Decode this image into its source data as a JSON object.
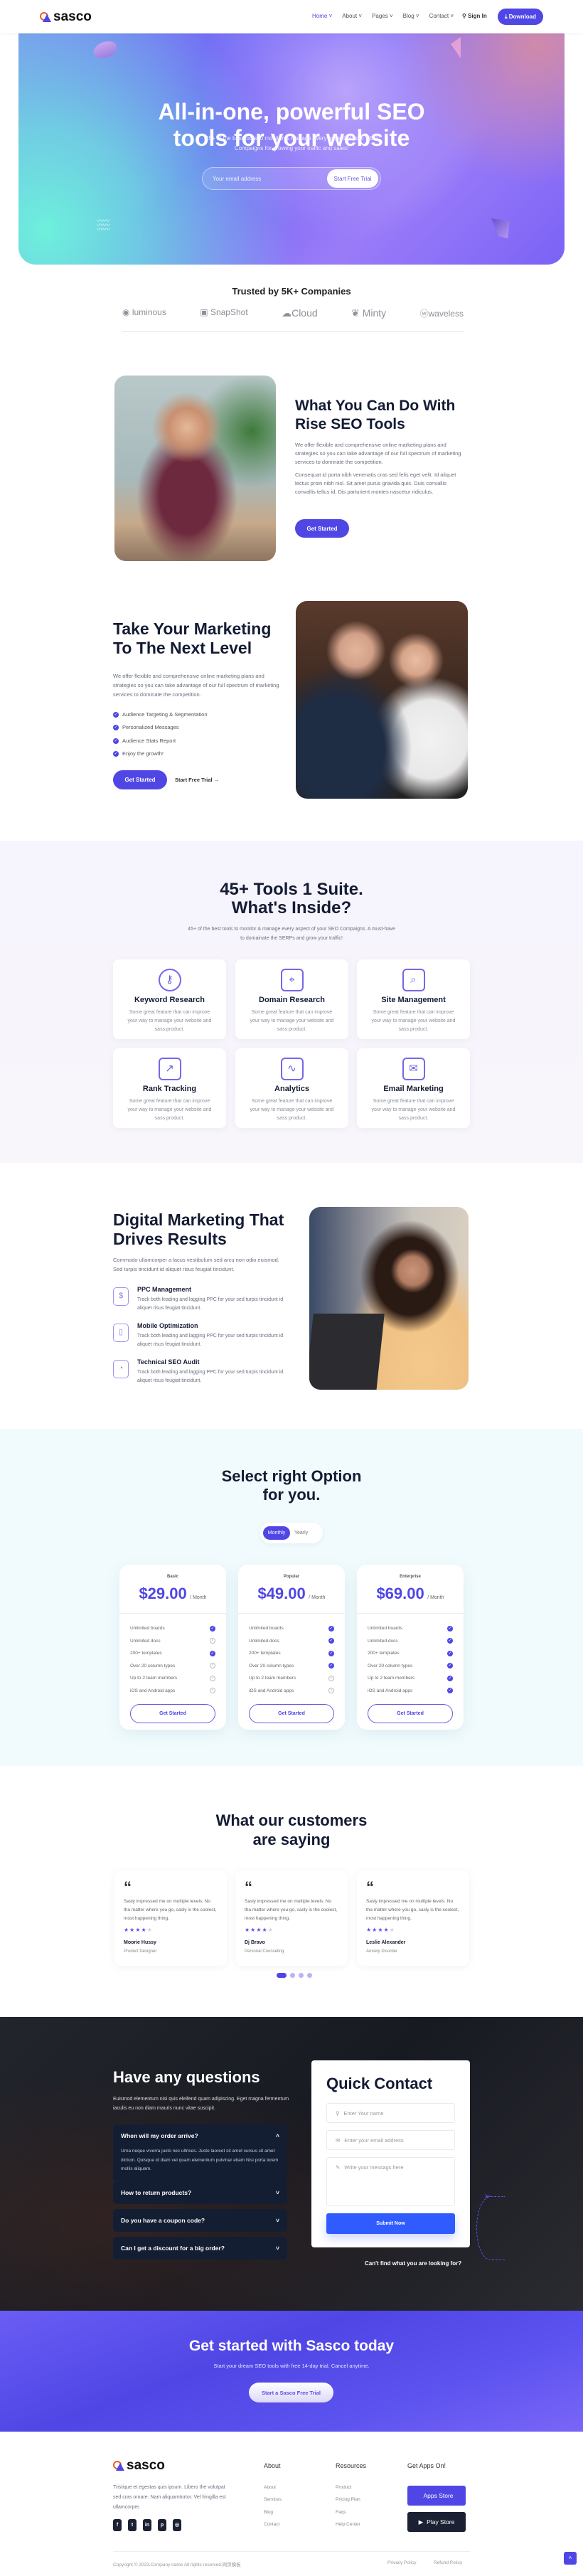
{
  "colors": {
    "primary": "#4f46e5",
    "heading": "#141b34",
    "accent_orange": "#f05a28",
    "dark_bg": "#1c2030"
  },
  "header": {
    "logo": "sasco",
    "nav": [
      "Home",
      "About",
      "Pages",
      "Blog",
      "Contact"
    ],
    "sign_in": "Sign In",
    "download": "Download"
  },
  "hero": {
    "title_line1": "All-in-one, powerful SEO",
    "title_line2": "tools for your website",
    "subtitle_line1": "45+ of the best tools to monitor & manage every aspect of your SEO",
    "subtitle_line2": "Compaigns for growing your traffic and sales!",
    "email_placeholder": "Your email address",
    "cta": "Start Free Trial"
  },
  "trusted": {
    "title": "Trusted by 5K+ Companies",
    "logos": [
      "luminous",
      "SnapShot",
      "Cloud",
      "Minty",
      "waveless"
    ]
  },
  "rise": {
    "title_line1": "What You Can Do With",
    "title_line2": "Rise SEO Tools",
    "para1": "We offer flexible and comprehensive online marketing plans and strategies so you can take advantage of our full spectrum of marketing services to dominate the competition.",
    "para2": "Consequat id porta nibh venenatis cras sed felis eget velit. Id aliquet lectus proin nibh nisl. Sit amet purus gravida quis. Duis convallis convallis tellus id. Dis parturient montes nascetur ridiculus.",
    "button": "Get Started"
  },
  "marketing": {
    "title_line1": "Take Your Marketing",
    "title_line2": "To The Next Level",
    "para": "We offer flexible and comprehensive online marketing plans and strategies so you can take advantage of our full spectrum of marketing services to dominate the competition.",
    "list": [
      "Audience Targeting & Segmentation",
      "Personalized Messages",
      "Audience Stats Report",
      "Enjoy the growth!"
    ],
    "primary_button": "Get Started",
    "secondary_button": "Start Free Trial"
  },
  "tools": {
    "title_line1": "45+ Tools 1 Suite.",
    "title_line2": "What's Inside?",
    "subtitle_line1": "45+ of the best tools to monitor & manage every aspect of your SEO Compaigns. A must-have",
    "subtitle_line2": "to domainate the SERPs and grow your traffic!",
    "cards": [
      {
        "icon": "key-search-icon",
        "title": "Keyword Research",
        "desc": "Some great feature that can improve your way to manage your website and sass product."
      },
      {
        "icon": "browser-cursor-icon",
        "title": "Domain Research",
        "desc": "Some great feature that can improve your way to manage your website and sass product."
      },
      {
        "icon": "site-search-icon",
        "title": "Site Management",
        "desc": "Some great feature that can improve your way to manage your website and sass product."
      },
      {
        "icon": "trend-chart-icon",
        "title": "Rank Tracking",
        "desc": "Some great feature that can improve your way to manage your website and sass product."
      },
      {
        "icon": "analytics-icon",
        "title": "Analytics",
        "desc": "Some great feature that can improve your way to manage your website and sass product."
      },
      {
        "icon": "email-megaphone-icon",
        "title": "Email Marketing",
        "desc": "Some great feature that can improve your way to manage your website and sass product."
      }
    ]
  },
  "digital": {
    "title_line1": "Digital Marketing That",
    "title_line2": "Drives Results",
    "para": "Commodo ullamcorper a lacus vestibulum sed arcu non odio euismod. Sed turpis tincidunt id aliquet risus feugiat tincidunt.",
    "features": [
      {
        "icon": "mouse-dollar-icon",
        "title": "PPC Management",
        "desc": "Track both leading and lagging PPC for your sed turpis tincidunt id aliquet risus feugiat tincidunt."
      },
      {
        "icon": "mobile-icon",
        "title": "Mobile Optimization",
        "desc": "Track both leading and lagging PPC for your sed turpis tincidunt id aliquet risus feugiat tincidunt."
      },
      {
        "icon": "presentation-icon",
        "title": "Technical SEO Audit",
        "desc": "Track both leading and lagging PPC for your sed turpis tincidunt id aliquet risus feugiat tincidunt."
      }
    ]
  },
  "pricing": {
    "title_line1": "Select right Option",
    "title_line2": "for you.",
    "toggle": [
      "Monthly",
      "Yearly"
    ],
    "toggle_selected": "Monthly",
    "feature_names": [
      "Unlimited boards",
      "Unlimited docs",
      "200+ templates",
      "Over 20 column types",
      "Up to 2 team members",
      "iOS and Android apps"
    ],
    "plans": [
      {
        "name": "Basic",
        "price": "$29.00",
        "period": "/ Month",
        "included": [
          true,
          false,
          true,
          false,
          false,
          false
        ],
        "button": "Get Started"
      },
      {
        "name": "Popular",
        "price": "$49.00",
        "period": "/ Month",
        "included": [
          true,
          true,
          true,
          true,
          false,
          false
        ],
        "button": "Get Started"
      },
      {
        "name": "Enterprise",
        "price": "$69.00",
        "period": "/ Month",
        "included": [
          true,
          true,
          true,
          true,
          true,
          true
        ],
        "button": "Get Started"
      }
    ]
  },
  "testimonials": {
    "title_line1": "What our customers",
    "title_line2": "are saying",
    "items": [
      {
        "quote": "Sasly impressed me on multiple levels. No tha matter where you go, sasly is the coolest, most happening thing.",
        "rating": 4,
        "name": "Moorie Hussy",
        "role": "Product Designer"
      },
      {
        "quote": "Sasly impressed me on multiple levels. No tha matter where you go, sasly is the coolest, most happening thing.",
        "rating": 4,
        "name": "Dj Bravo",
        "role": "Personal Counseling"
      },
      {
        "quote": "Sasly impressed me on multiple levels. No tha matter where you go, sasly is the coolest, most happening thing.",
        "rating": 4,
        "name": "Leslie Alexander",
        "role": "Anxiety Disorder"
      }
    ],
    "pages": 4,
    "active_page": 1
  },
  "faq": {
    "title": "Have any questions",
    "para": "Euismod elementum nisi quis eleifend quam adipiscing. Eget magna fermentum iaculis eu non diam mauris nunc vitae suscipit.",
    "items": [
      {
        "q": "When will my order arrive?",
        "a": "Urna neque viverra justo nec ultrices. Justo laoreet sit amet cursus sit amet dictum. Quisque id diam vel quam elementum pulvinar etiam Nisi porta lorem mollis aliquam.",
        "open": true
      },
      {
        "q": "How to return products?",
        "open": false
      },
      {
        "q": "Do you have a coupon code?",
        "open": false
      },
      {
        "q": "Can I get a discount for a big order?",
        "open": false
      }
    ]
  },
  "contact": {
    "title": "Quick Contact",
    "name_placeholder": "Enter Your name",
    "email_placeholder": "Enter your email address",
    "message_placeholder": "Write your messags here",
    "submit": "Submit Now",
    "help": "Can't find what you are looking for?"
  },
  "cta": {
    "title": "Get started with Sasco today",
    "subtitle": "Start your dream SEO tools with free 14-day trial. Cancel anytime.",
    "button": "Start a Sasco Free Trial"
  },
  "footer": {
    "logo": "sasco",
    "about_text": "Tristique et egestas quis ipsum. Libero the volutpat sed cras ornare. Nam aliquamtortor. Vel fringilla est ullamcorper.",
    "social": [
      "facebook",
      "twitter",
      "linkedin",
      "pinterest",
      "instagram"
    ],
    "col_about": {
      "title": "About",
      "links": [
        "About",
        "Services",
        "Blog",
        "Contact"
      ]
    },
    "col_resources": {
      "title": "Resources",
      "links": [
        "Product",
        "Pricing Plan",
        "Faqs",
        "Help Center"
      ]
    },
    "apps": {
      "title": "Get Apps On!",
      "app_store": "Apps Store",
      "play_store": "Play Store"
    },
    "copyright": "Copyright © 2023.Company name All rights reserved.网页模板",
    "privacy": "Privacy Policy",
    "refund": "Refund Policy"
  }
}
